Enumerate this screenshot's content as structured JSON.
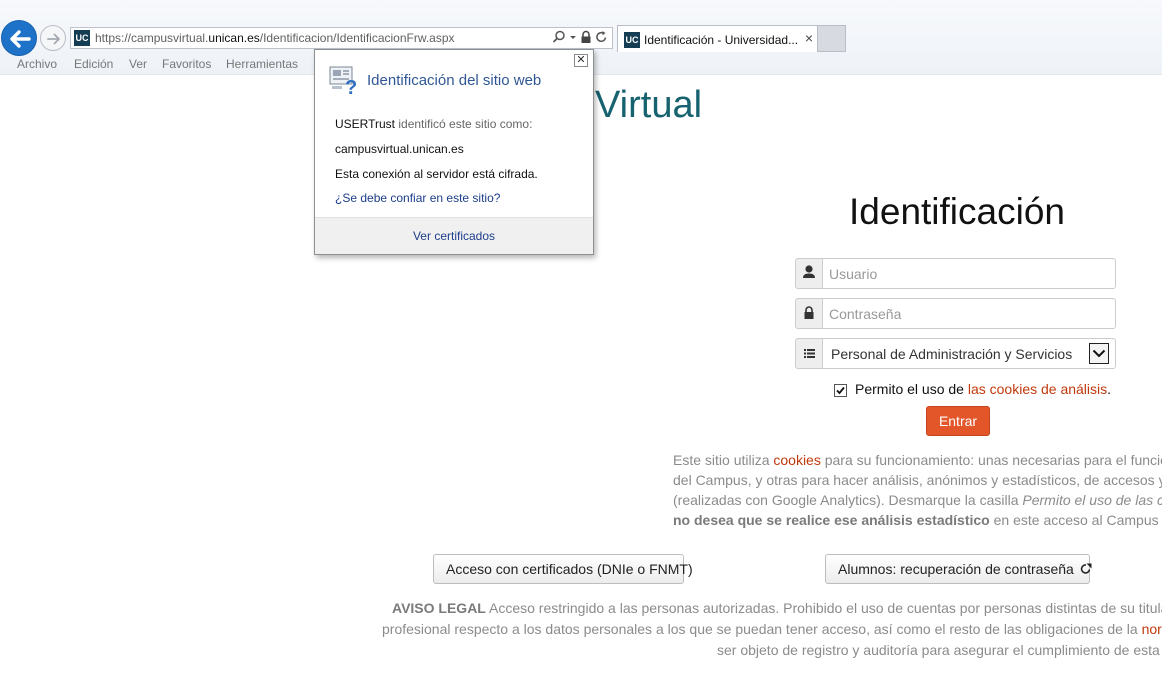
{
  "browser": {
    "url": {
      "prefix": "https://campusvirtual.",
      "domain": "unican.es",
      "path": "/Identificacion/IdentificacionFrw.aspx"
    },
    "favicon_text": "UC",
    "tab": {
      "title": "Identificación - Universidad...",
      "close_glyph": "×"
    },
    "menu": [
      "Archivo",
      "Edición",
      "Ver",
      "Favoritos",
      "Herramientas"
    ]
  },
  "popup": {
    "title": "Identificación del sitio web",
    "issuer": "USERTrust",
    "issuer_suffix": " identificó este sitio como:",
    "site": "campusvirtual.unican.es",
    "encryption": "Esta conexión al servidor está cifrada.",
    "trust_link": "¿Se debe confiar en este sitio?",
    "certificates_link": "Ver certificados",
    "close_glyph": "✕"
  },
  "page": {
    "site_title": "Virtual",
    "login_heading": "Identificación",
    "username_placeholder": "Usuario",
    "password_placeholder": "Contraseña",
    "profile_selected": "Personal de Administración y Servicios",
    "cookie_consent": {
      "prefix": "Permito el uso de ",
      "link": "las cookies de análisis",
      "suffix": ".",
      "checked": true
    },
    "enter_button": "Entrar",
    "cookie_info": {
      "l1_a": "Este sitio utiliza ",
      "l1_link": "cookies",
      "l1_b": " para su funcionamiento: unas necesarias para el funcionam",
      "l2": "del Campus, y otras para hacer análisis, anónimos y estadísticos, de accesos y uso",
      "l3_a": "(realizadas con Google Analytics). Desmarque la casilla ",
      "l3_em": "Permito el uso de las cookies",
      "l4_b": "no desea que se realice ese análisis estadístico",
      "l4_rest": " en este acceso al Campus Virtual."
    },
    "certificate_button": "Acceso con certificados (DNIe o FNMT)",
    "password_recovery_button": "Alumnos: recuperación de contraseña",
    "legal": {
      "l1_b": "AVISO LEGAL",
      "l1_rest": " Acceso restringido a las personas autorizadas. Prohibido el uso de cuentas por personas distintas de su titular. Pulsar '",
      "l2_a": "profesional respecto a los datos personales a los que se puedan tener acceso, así como el resto de las obligaciones de la ",
      "l2_link": "normativa inte",
      "l3": "ser objeto de registro y auditoría para asegurar el cumplimiento de esta norm"
    }
  },
  "colors": {
    "brand_teal": "#17626f",
    "accent_orange": "#e2562a",
    "link_red": "#c0390b",
    "popup_title_blue": "#2f5795",
    "ie_back_blue": "#1e73c9"
  },
  "icons": {
    "back": "arrow-left-icon",
    "forward": "arrow-right-icon",
    "search": "search-icon",
    "lock": "lock-icon",
    "refresh": "refresh-icon",
    "user": "user-icon",
    "password": "lock-icon",
    "profile": "list-icon",
    "dropdown": "chevron-down-icon",
    "external": "external-link-icon",
    "certificate": "certificate-icon"
  }
}
